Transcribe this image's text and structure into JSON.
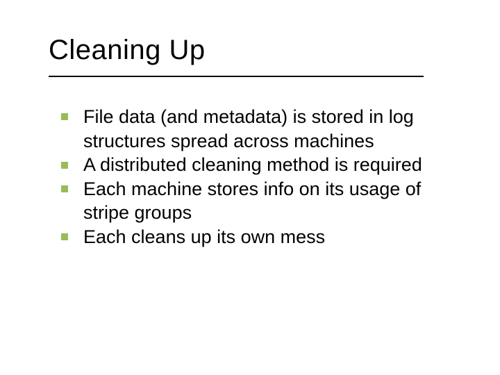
{
  "slide": {
    "title": "Cleaning Up",
    "bullets": [
      "File data (and metadata) is stored in log structures spread across machines",
      "A distributed cleaning method is required",
      "Each machine stores info on its usage of stripe groups",
      "Each cleans up its own mess"
    ]
  }
}
